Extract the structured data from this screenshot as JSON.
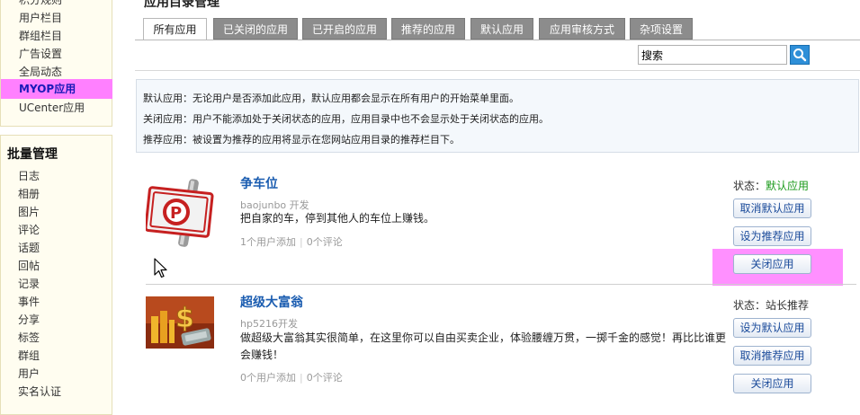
{
  "sidebar": {
    "top_items": [
      {
        "label": "积分规则",
        "active": false
      },
      {
        "label": "用户栏目",
        "active": false
      },
      {
        "label": "群组栏目",
        "active": false
      },
      {
        "label": "广告设置",
        "active": false
      },
      {
        "label": "全局动态",
        "active": false
      },
      {
        "label": "MYOP应用",
        "active": true
      },
      {
        "label": "UCenter应用",
        "active": false
      }
    ],
    "section_heading": "批量管理",
    "batch_items": [
      {
        "label": "日志"
      },
      {
        "label": "相册"
      },
      {
        "label": "图片"
      },
      {
        "label": "评论"
      },
      {
        "label": "话题"
      },
      {
        "label": "回帖"
      },
      {
        "label": "记录"
      },
      {
        "label": "事件"
      },
      {
        "label": "分享"
      },
      {
        "label": "标签"
      },
      {
        "label": "群组"
      },
      {
        "label": "用户"
      },
      {
        "label": "实名认证"
      }
    ]
  },
  "page": {
    "title": "应用目录管理",
    "tabs": [
      {
        "label": "所有应用",
        "active": true
      },
      {
        "label": "已关闭的应用",
        "active": false
      },
      {
        "label": "已开启的应用",
        "active": false
      },
      {
        "label": "推荐的应用",
        "active": false
      },
      {
        "label": "默认应用",
        "active": false
      },
      {
        "label": "应用审核方式",
        "active": false
      },
      {
        "label": "杂项设置",
        "active": false
      }
    ],
    "search": {
      "value": "搜索",
      "icon": "search-icon"
    },
    "notice": [
      "默认应用：无论用户是否添加此应用，默认应用都会显示在所有用户的开始菜单里面。",
      "关闭应用：用户不能添加处于关闭状态的应用，应用目录中也不会显示处于关闭状态的应用。",
      "推荐应用：被设置为推荐的应用将显示在您网站应用目录的推荐栏目下。"
    ]
  },
  "apps": [
    {
      "name": "争车位",
      "author": "baojunbo 开发",
      "description": "把自家的车，停到其他人的车位上赚钱。",
      "users": "1个用户添加",
      "comments": "0个评论",
      "status_label": "状态：",
      "status_value": "默认应用",
      "buttons": [
        "取消默认应用",
        "设为推荐应用",
        "关闭应用"
      ]
    },
    {
      "name": "超级大富翁",
      "author": "hp5216开发",
      "description": "做超级大富翁其实很简单，在这里你可以自由买卖企业，体验腰缠万贯，一掷千金的感觉！再比比谁更会赚钱！",
      "users": "0个用户添加",
      "comments": "0个评论",
      "status_label": "状态：",
      "status_value": "站长推荐",
      "buttons": [
        "设为默认应用",
        "取消推荐应用",
        "关闭应用"
      ]
    }
  ],
  "colors": {
    "active_highlight": "#ff80ff",
    "link_blue": "#1a5cb0",
    "status_green": "#1a9a1a",
    "tab_inactive": "#8c8c8c"
  }
}
